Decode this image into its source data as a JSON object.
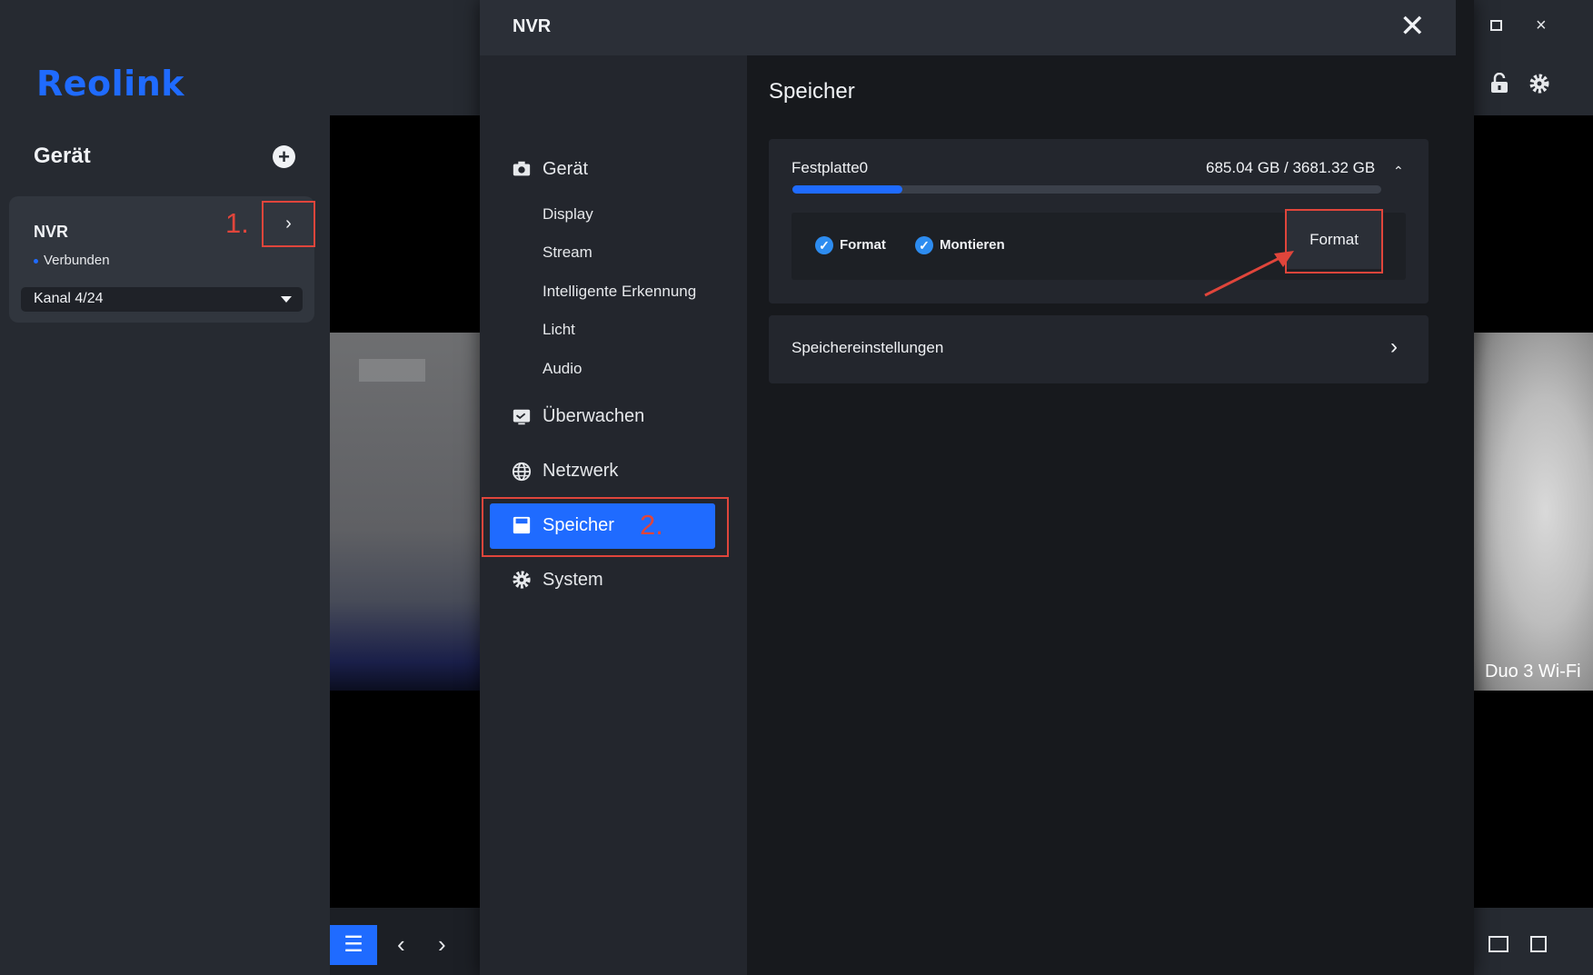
{
  "app": {
    "logo": "Reolink",
    "device_panel_title": "Gerät",
    "add_device_icon": "plus-circle-icon",
    "nvr_card": {
      "name": "NVR",
      "status": "Verbunden",
      "open_icon": "chevron-right-icon",
      "channel_select": "Kanal 4/24"
    },
    "camera_label": "Duo 3 Wi-Fi",
    "layout_icon": "layout-list-icon"
  },
  "annotations": {
    "step1": "1.",
    "step2": "2.",
    "color": "#e0453b"
  },
  "modal": {
    "title": "NVR",
    "close_icon": "close-icon",
    "sidebar": {
      "groups": [
        {
          "label": "Gerät",
          "icon": "camera-icon",
          "subitems": [
            "Display",
            "Stream",
            "Intelligente Erkennung",
            "Licht",
            "Audio"
          ]
        },
        {
          "label": "Überwachen",
          "icon": "monitor-icon"
        },
        {
          "label": "Netzwerk",
          "icon": "globe-icon"
        },
        {
          "label": "Speicher",
          "icon": "storage-icon",
          "active": true
        },
        {
          "label": "System",
          "icon": "gear-icon"
        }
      ]
    },
    "content": {
      "title": "Speicher",
      "disk": {
        "name": "Festplatte0",
        "usage": "685.04 GB / 3681.32 GB",
        "used_fraction": 0.186,
        "checks": [
          "Format",
          "Montieren"
        ],
        "format_button": "Format"
      },
      "settings_row": "Speichereinstellungen"
    }
  },
  "colors": {
    "accent": "#1f6bff",
    "check": "#2d8cf0",
    "annotation": "#e0453b"
  }
}
